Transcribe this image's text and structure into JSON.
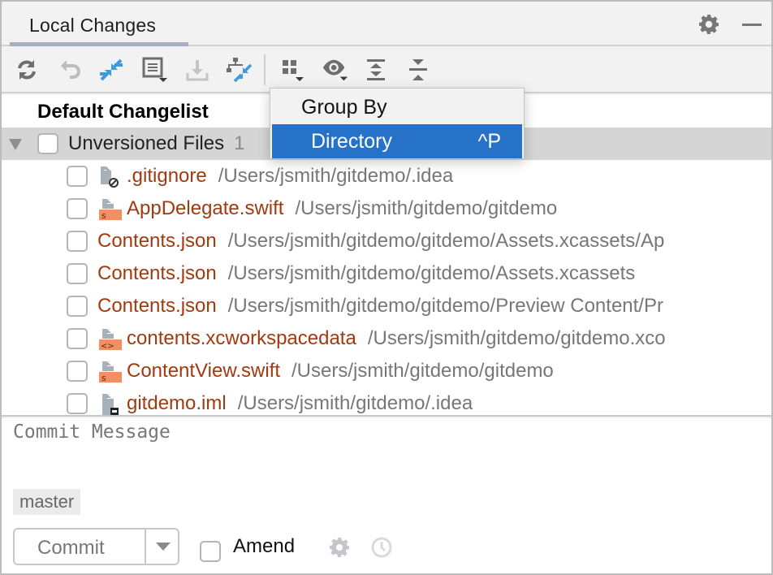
{
  "header": {
    "tab_label": "Local Changes",
    "icons": [
      "gear-icon",
      "minimize-icon"
    ]
  },
  "toolbar": {
    "buttons": [
      {
        "name": "refresh",
        "icon": "refresh-icon",
        "enabled": true
      },
      {
        "name": "rollback",
        "icon": "undo-icon",
        "enabled": false
      },
      {
        "name": "show-diff",
        "icon": "diff-arrows-icon",
        "enabled": true
      },
      {
        "name": "changelists",
        "icon": "changelist-menu-icon",
        "enabled": true
      },
      {
        "name": "shelve",
        "icon": "download-icon",
        "enabled": false
      },
      {
        "name": "compare-branches",
        "icon": "structure-diff-icon",
        "enabled": true
      },
      {
        "name": "group-by",
        "icon": "group-by-icon",
        "enabled": true
      },
      {
        "name": "view-options",
        "icon": "eye-icon",
        "enabled": true
      },
      {
        "name": "expand-all",
        "icon": "expand-all-icon",
        "enabled": true
      },
      {
        "name": "collapse-all",
        "icon": "collapse-all-icon",
        "enabled": true
      }
    ]
  },
  "popup": {
    "title": "Group By",
    "items": [
      {
        "label": "Directory",
        "shortcut": "^P",
        "selected": true
      }
    ]
  },
  "tree": {
    "changelist": "Default Changelist",
    "group": {
      "label": "Unversioned Files",
      "count": "1"
    },
    "files": [
      {
        "name": ".gitignore",
        "path": "/Users/jsmith/gitdemo/.idea",
        "icon": "ignored-file-icon"
      },
      {
        "name": "AppDelegate.swift",
        "path": "/Users/jsmith/gitdemo/gitdemo",
        "icon": "swift-file-icon"
      },
      {
        "name": "Contents.json",
        "path": "/Users/jsmith/gitdemo/gitdemo/Assets.xcassets/Ap",
        "icon": ""
      },
      {
        "name": "Contents.json",
        "path": "/Users/jsmith/gitdemo/gitdemo/Assets.xcassets",
        "icon": ""
      },
      {
        "name": "Contents.json",
        "path": "/Users/jsmith/gitdemo/gitdemo/Preview Content/Pr",
        "icon": ""
      },
      {
        "name": "contents.xcworkspacedata",
        "path": "/Users/jsmith/gitdemo/gitdemo.xco",
        "icon": "xml-file-icon"
      },
      {
        "name": "ContentView.swift",
        "path": "/Users/jsmith/gitdemo/gitdemo",
        "icon": "swift-file-icon"
      },
      {
        "name": "gitdemo.iml",
        "path": "/Users/jsmith/gitdemo/.idea",
        "icon": "module-file-icon"
      }
    ]
  },
  "commit": {
    "message_placeholder": "Commit Message",
    "branch": "master",
    "commit_label": "Commit",
    "amend_label": "Amend",
    "amend_checked": false
  },
  "colors": {
    "accent": "#2672c8",
    "unversioned_file": "#a23a0f",
    "path": "#777777",
    "diff_blue": "#3d9bdb"
  }
}
